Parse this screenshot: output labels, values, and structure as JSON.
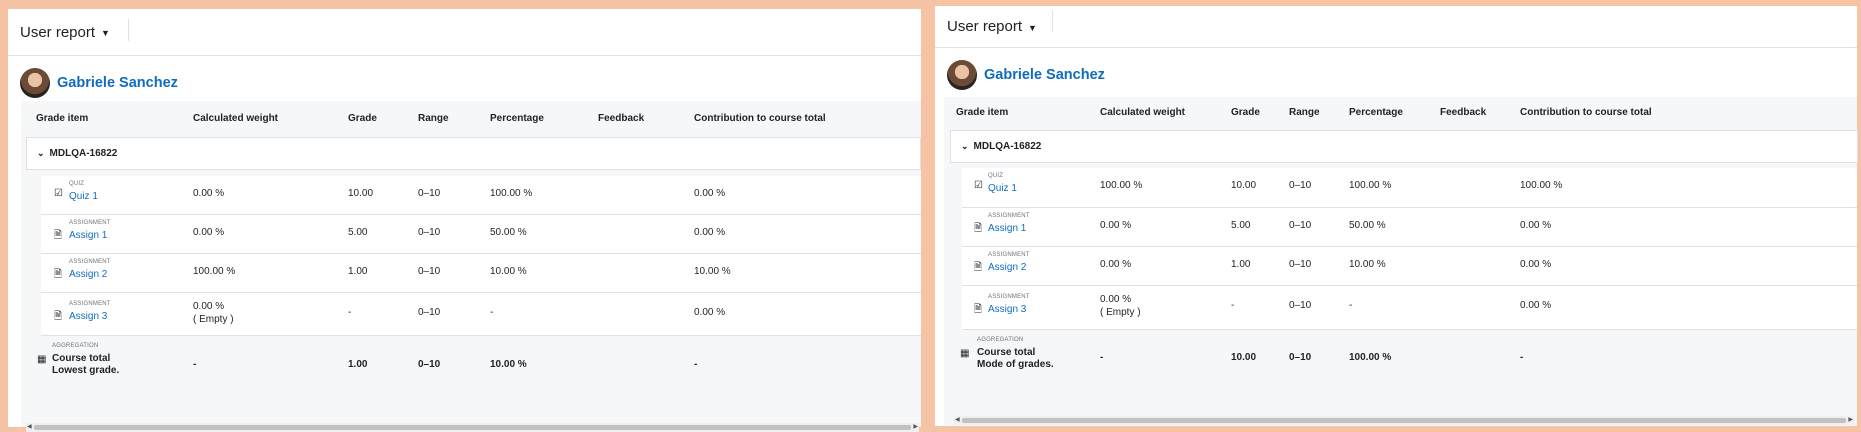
{
  "panels": [
    {
      "report_title": "User report",
      "user_name": "Gabriele Sanchez",
      "headers": [
        "Grade item",
        "Calculated weight",
        "Grade",
        "Range",
        "Percentage",
        "Feedback",
        "Contribution to course total"
      ],
      "category": "MDLQA-16822",
      "items": [
        {
          "type": "QUIZ",
          "name": "Quiz 1",
          "icon": "quiz-check-icon",
          "weight": "0.00 %",
          "weight2": "",
          "grade": "10.00",
          "range": "0–10",
          "percentage": "100.00 %",
          "feedback": "",
          "contribution": "0.00 %"
        },
        {
          "type": "ASSIGNMENT",
          "name": "Assign 1",
          "icon": "assignment-icon",
          "weight": "0.00 %",
          "weight2": "",
          "grade": "5.00",
          "range": "0–10",
          "percentage": "50.00 %",
          "feedback": "",
          "contribution": "0.00 %"
        },
        {
          "type": "ASSIGNMENT",
          "name": "Assign 2",
          "icon": "assignment-icon",
          "weight": "100.00 %",
          "weight2": "",
          "grade": "1.00",
          "range": "0–10",
          "percentage": "10.00 %",
          "feedback": "",
          "contribution": "10.00 %"
        },
        {
          "type": "ASSIGNMENT",
          "name": "Assign 3",
          "icon": "assignment-icon",
          "weight": "0.00 %",
          "weight2": "( Empty )",
          "grade": "-",
          "range": "0–10",
          "percentage": "-",
          "feedback": "",
          "contribution": "0.00 %"
        }
      ],
      "total": {
        "type": "AGGREGATION",
        "name": "Course total",
        "method": "Lowest grade.",
        "weight": "-",
        "grade": "1.00",
        "range": "0–10",
        "percentage": "10.00 %",
        "contribution": "-"
      }
    },
    {
      "report_title": "User report",
      "user_name": "Gabriele Sanchez",
      "headers": [
        "Grade item",
        "Calculated weight",
        "Grade",
        "Range",
        "Percentage",
        "Feedback",
        "Contribution to course total"
      ],
      "category": "MDLQA-16822",
      "items": [
        {
          "type": "QUIZ",
          "name": "Quiz 1",
          "icon": "quiz-check-icon",
          "weight": "100.00 %",
          "weight2": "",
          "grade": "10.00",
          "range": "0–10",
          "percentage": "100.00 %",
          "feedback": "",
          "contribution": "100.00 %"
        },
        {
          "type": "ASSIGNMENT",
          "name": "Assign 1",
          "icon": "assignment-icon",
          "weight": "0.00 %",
          "weight2": "",
          "grade": "5.00",
          "range": "0–10",
          "percentage": "50.00 %",
          "feedback": "",
          "contribution": "0.00 %"
        },
        {
          "type": "ASSIGNMENT",
          "name": "Assign 2",
          "icon": "assignment-icon",
          "weight": "0.00 %",
          "weight2": "",
          "grade": "1.00",
          "range": "0–10",
          "percentage": "10.00 %",
          "feedback": "",
          "contribution": "0.00 %"
        },
        {
          "type": "ASSIGNMENT",
          "name": "Assign 3",
          "icon": "assignment-icon",
          "weight": "0.00 %",
          "weight2": "( Empty )",
          "grade": "-",
          "range": "0–10",
          "percentage": "-",
          "feedback": "",
          "contribution": "0.00 %"
        }
      ],
      "total": {
        "type": "AGGREGATION",
        "name": "Course total",
        "method": "Mode of grades.",
        "weight": "-",
        "grade": "10.00",
        "range": "0–10",
        "percentage": "100.00 %",
        "contribution": "-"
      }
    }
  ]
}
